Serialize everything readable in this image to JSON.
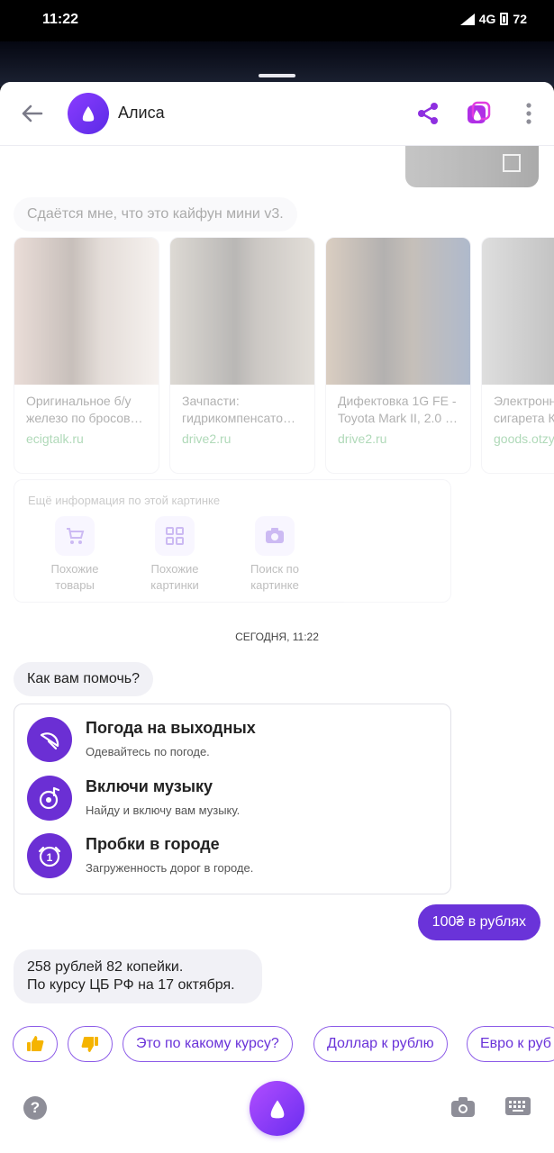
{
  "status_bar": {
    "time": "11:22",
    "network": "4G",
    "battery": "72"
  },
  "header": {
    "title": "Алиса",
    "back_icon": "arrow-left-icon",
    "share_icon": "share-icon",
    "skills_icon": "alice-skills-icon",
    "menu_icon": "more-vert-icon"
  },
  "history": {
    "guess": "Сдаётся мне, что это кайфун мини v3.",
    "cards": [
      {
        "caption": "Оригинальное б/у железо по бросов…",
        "source": "ecigtalk.ru"
      },
      {
        "caption": "Зачпасти: гидрикомпенсато…",
        "source": "drive2.ru"
      },
      {
        "caption": "Дифектовка 1G FE - Toyota Mark II, 2.0 …",
        "source": "drive2.ru"
      },
      {
        "caption": "Электронная сигарета К…",
        "source": "goods.otzy…"
      }
    ],
    "more_info": {
      "header": "Ещё информация по этой картинке",
      "options": [
        {
          "label_1": "Похожие",
          "label_2": "товары",
          "icon": "cart-icon"
        },
        {
          "label_1": "Похожие",
          "label_2": "картинки",
          "icon": "grid-icon"
        },
        {
          "label_1": "Поиск по",
          "label_2": "картинке",
          "icon": "camera-search-icon"
        }
      ]
    }
  },
  "date_separator": "СЕГОДНЯ, 11:22",
  "greeting": "Как вам помочь?",
  "suggestions": [
    {
      "title": "Погода на выходных",
      "subtitle": "Одевайтесь по погоде.",
      "icon": "umbrella-icon"
    },
    {
      "title": "Включи музыку",
      "subtitle": "Найду и включу вам музыку.",
      "icon": "music-icon"
    },
    {
      "title": "Пробки в городе",
      "subtitle": "Загруженность дорог в городе.",
      "icon": "traffic-icon"
    }
  ],
  "user_message": "100₴ в рублях",
  "answer": {
    "line1": "258 рублей 82 копейки.",
    "line2": "По курсу ЦБ РФ на 17 октября."
  },
  "chips": [
    "Это по какому курсу?",
    "Доллар к рублю",
    "Евро к руб"
  ],
  "feedback": {
    "like_icon": "thumbs-up-icon",
    "dislike_icon": "thumbs-down-icon"
  },
  "bottom_bar": {
    "help": "?",
    "alice_icon": "alice-icon",
    "camera_icon": "camera-icon",
    "keyboard_icon": "keyboard-icon"
  },
  "colors": {
    "accent": "#6a33d9",
    "link_green": "#2f9d46",
    "bubble_grey": "#f1f1f6"
  }
}
